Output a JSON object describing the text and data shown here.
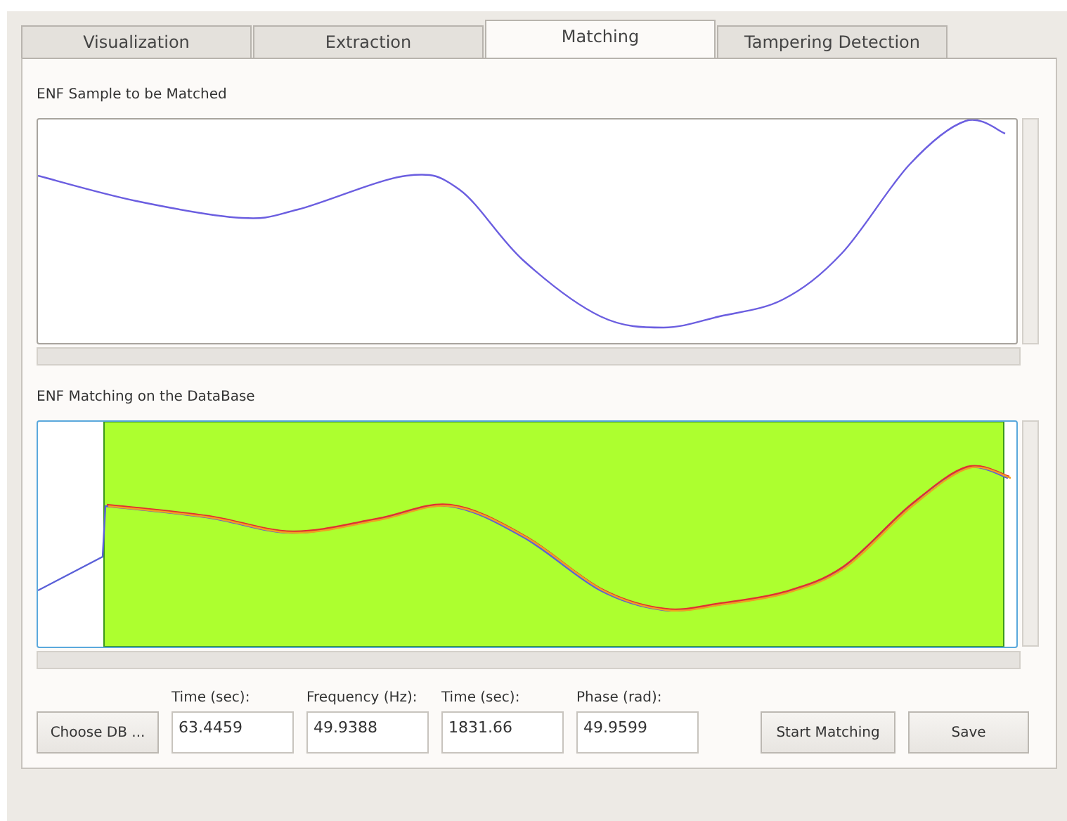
{
  "tabs": [
    {
      "label": "Visualization",
      "selected": false
    },
    {
      "label": "Extraction",
      "selected": false
    },
    {
      "label": "Matching",
      "selected": true
    },
    {
      "label": "Tampering Detection",
      "selected": false
    }
  ],
  "sample_plot": {
    "title": "ENF Sample to be Matched"
  },
  "matching_plot": {
    "title": "ENF Matching on the DataBase"
  },
  "choose_button": "Choose DB ...",
  "fields": [
    {
      "label": "Time (sec):",
      "value": "63.4459"
    },
    {
      "label": "Frequency (Hz):",
      "value": "49.9388"
    },
    {
      "label": "Time (sec):",
      "value": "1831.66"
    },
    {
      "label": "Phase (rad):",
      "value": "49.9599"
    }
  ],
  "buttons": [
    "Start Matching",
    "Save"
  ]
}
